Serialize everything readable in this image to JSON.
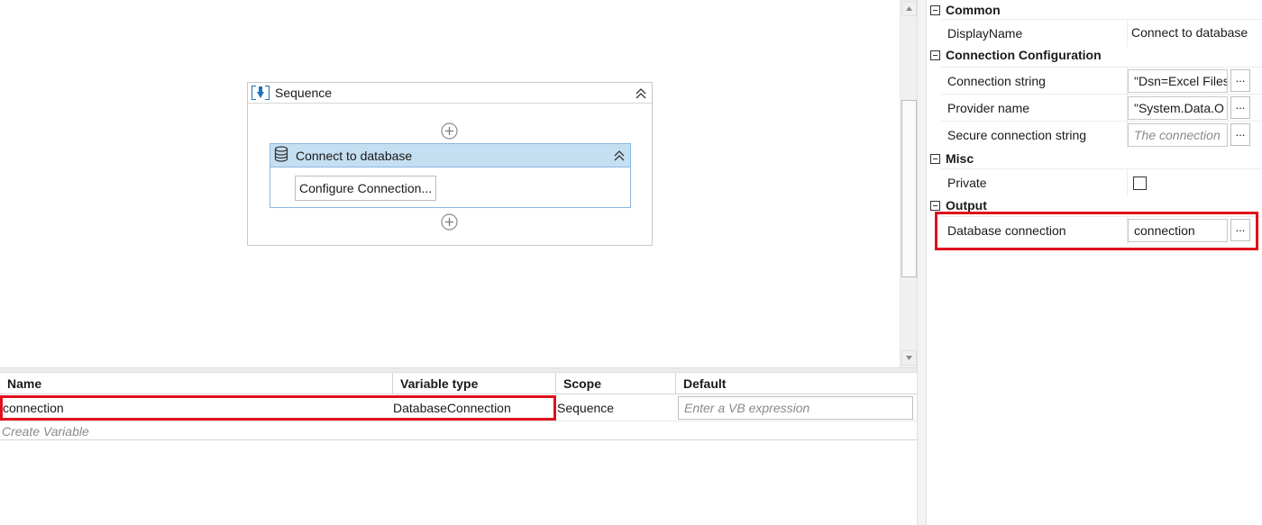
{
  "designer": {
    "sequence_title": "Sequence",
    "activity_title": "Connect to database",
    "configure_button": "Configure Connection..."
  },
  "variables": {
    "columns": [
      "Name",
      "Variable type",
      "Scope",
      "Default"
    ],
    "rows": [
      {
        "name": "connection",
        "type": "DatabaseConnection",
        "scope": "Sequence",
        "default_placeholder": "Enter a VB expression"
      }
    ],
    "create_label": "Create Variable"
  },
  "properties": {
    "categories": {
      "common": "Common",
      "connection": "Connection Configuration",
      "misc": "Misc",
      "output": "Output"
    },
    "display_name": {
      "label": "DisplayName",
      "value": "Connect to database"
    },
    "connection_string": {
      "label": "Connection string",
      "value": "\"Dsn=Excel Files"
    },
    "provider_name": {
      "label": "Provider name",
      "value": "\"System.Data.O"
    },
    "secure_connection_string": {
      "label": "Secure connection string",
      "placeholder": "The connection"
    },
    "private": {
      "label": "Private",
      "checked": false
    },
    "database_connection": {
      "label": "Database connection",
      "value": "connection"
    },
    "browse_label": "..."
  },
  "colors": {
    "highlight": "#e0101b",
    "activity_header": "#c5dff2",
    "accent": "#1e73be"
  }
}
